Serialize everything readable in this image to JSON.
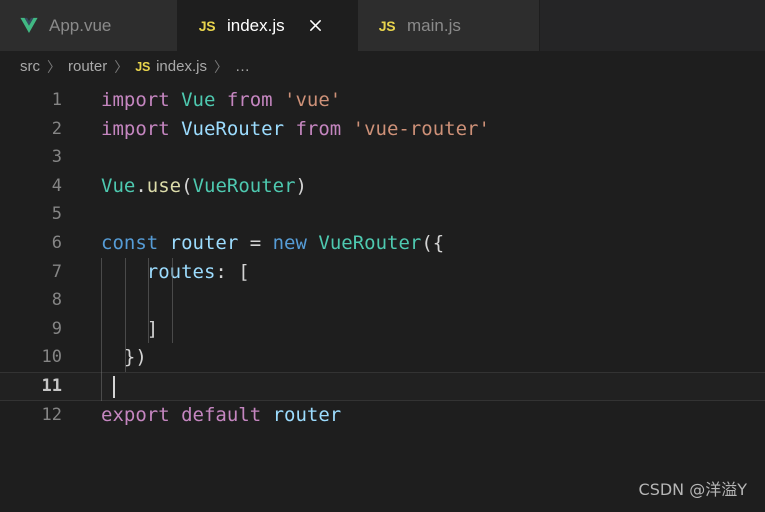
{
  "window": {
    "app": "Visual Studio Code",
    "theme": "Dark+",
    "bg": "#1e1e1e",
    "tabbar_bg": "#252526",
    "tab_inactive_bg": "#2d2d2d"
  },
  "tabs": [
    {
      "label": "App.vue",
      "icon": "vue-logo-icon",
      "active": false,
      "closable": false
    },
    {
      "label": "index.js",
      "icon": "js-file-icon",
      "active": true,
      "closable": true,
      "close_glyph": "×"
    },
    {
      "label": "main.js",
      "icon": "js-file-icon",
      "active": false,
      "closable": false
    }
  ],
  "breadcrumb": {
    "separator": "〉",
    "js_badge": "JS",
    "items": [
      {
        "label": "src"
      },
      {
        "label": "router"
      },
      {
        "label": "index.js"
      },
      {
        "label": "…"
      }
    ]
  },
  "editor": {
    "language": "javascript",
    "active_line": 11,
    "cursor": {
      "line": 11,
      "column": 2
    },
    "lines": [
      {
        "n": "1",
        "tokens": [
          {
            "t": "import ",
            "c": "t-kw"
          },
          {
            "t": "Vue",
            "c": "t-type"
          },
          {
            "t": " from ",
            "c": "t-kw"
          },
          {
            "t": "'vue'",
            "c": "t-str"
          }
        ]
      },
      {
        "n": "2",
        "tokens": [
          {
            "t": "import ",
            "c": "t-kw"
          },
          {
            "t": "VueRouter",
            "c": "t-var"
          },
          {
            "t": " from ",
            "c": "t-kw"
          },
          {
            "t": "'vue-router'",
            "c": "t-str"
          }
        ]
      },
      {
        "n": "3",
        "tokens": []
      },
      {
        "n": "4",
        "tokens": [
          {
            "t": "Vue",
            "c": "t-type"
          },
          {
            "t": ".",
            "c": "t-pl"
          },
          {
            "t": "use",
            "c": "t-fn"
          },
          {
            "t": "(",
            "c": "t-pl"
          },
          {
            "t": "VueRouter",
            "c": "t-type"
          },
          {
            "t": ")",
            "c": "t-pl"
          }
        ]
      },
      {
        "n": "5",
        "tokens": []
      },
      {
        "n": "6",
        "tokens": [
          {
            "t": "const ",
            "c": "t-blue"
          },
          {
            "t": "router",
            "c": "t-var"
          },
          {
            "t": " = ",
            "c": "t-pl"
          },
          {
            "t": "new ",
            "c": "t-blue"
          },
          {
            "t": "VueRouter",
            "c": "t-type"
          },
          {
            "t": "({",
            "c": "t-pl"
          }
        ]
      },
      {
        "n": "7",
        "indent": 4,
        "tokens": [
          {
            "t": "    routes",
            "c": "t-var"
          },
          {
            "t": ": [",
            "c": "t-pl"
          }
        ]
      },
      {
        "n": "8",
        "indent": 4,
        "tokens": []
      },
      {
        "n": "9",
        "indent": 4,
        "tokens": [
          {
            "t": "    ]",
            "c": "t-pl"
          }
        ]
      },
      {
        "n": "10",
        "indent": 2,
        "tokens": [
          {
            "t": "  })",
            "c": "t-pl"
          }
        ]
      },
      {
        "n": "11",
        "indent": 1,
        "tokens": [],
        "active": true
      },
      {
        "n": "12",
        "tokens": [
          {
            "t": "export default ",
            "c": "t-kw"
          },
          {
            "t": "router",
            "c": "t-var"
          }
        ]
      }
    ]
  },
  "watermark": {
    "text": "CSDN @洋溢Y"
  },
  "colors": {
    "keyword": "#C586C0",
    "type": "#4EC9B0",
    "string": "#CE9178",
    "blue_keyword": "#569CD6",
    "variable": "#9CDCFE",
    "function": "#DCDCAA",
    "plain": "#d4d4d4",
    "line_number": "#858585",
    "js_badge": "#e8d44d",
    "vue_green": "#41B883",
    "vue_dark": "#35495E"
  }
}
